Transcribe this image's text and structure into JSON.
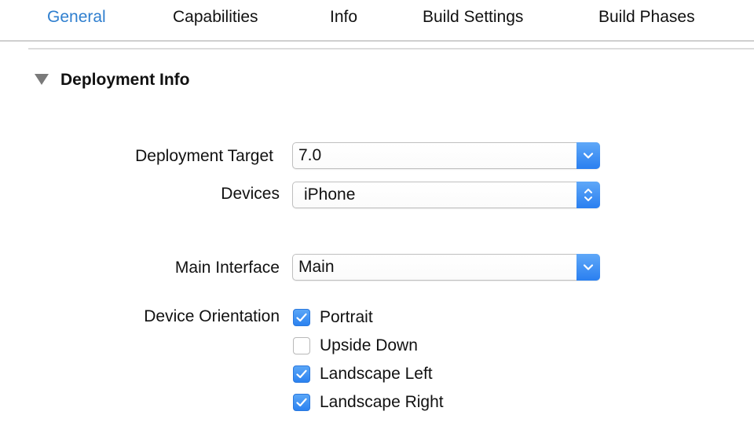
{
  "tabs": {
    "general": "General",
    "capabilities": "Capabilities",
    "info": "Info",
    "build_settings": "Build Settings",
    "build_phases": "Build Phases"
  },
  "section": {
    "title": "Deployment Info"
  },
  "deployment_target": {
    "label": "Deployment Target",
    "value": "7.0"
  },
  "devices": {
    "label": "Devices",
    "value": "iPhone"
  },
  "main_interface": {
    "label": "Main Interface",
    "value": "Main"
  },
  "orientation": {
    "label": "Device Orientation",
    "options": [
      {
        "label": "Portrait",
        "checked": true
      },
      {
        "label": "Upside Down",
        "checked": false
      },
      {
        "label": "Landscape Left",
        "checked": true
      },
      {
        "label": "Landscape Right",
        "checked": true
      }
    ]
  },
  "colors": {
    "accent": "#2f7fcf",
    "control_blue": "#2b82f0"
  },
  "icons": {
    "disclosure": "disclosure-triangle-icon",
    "dropdown": "chevron-down-icon",
    "stepper": "up-down-chevron-icon",
    "check": "checkmark-icon"
  }
}
